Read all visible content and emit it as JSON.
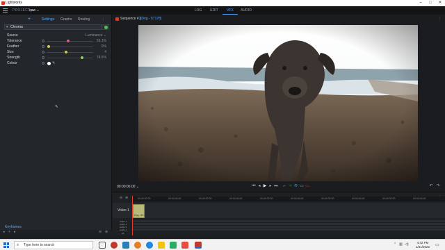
{
  "window": {
    "title": "Lightworks",
    "controls": [
      "–",
      "□",
      "✕"
    ]
  },
  "app": {
    "project_label": "PROJECT",
    "project_name": "qaw ⌄",
    "modes": [
      "LOG",
      "EDIT",
      "VFX",
      "AUDIO"
    ],
    "active_mode": "VFX"
  },
  "left_panel": {
    "add_label": "+",
    "tabs": [
      "Settings",
      "Graphs",
      "Routing"
    ],
    "active_tab": "Settings",
    "effect_name": "Chroma",
    "params": [
      {
        "label": "Source",
        "value": "Luminance ⌄"
      },
      {
        "label": "Tolerance",
        "value": "56.1%",
        "level": 0.45,
        "knob_color": "#d65a8a"
      },
      {
        "label": "Feather",
        "value": "0%",
        "level": 0.0,
        "knob_color": "#d4c84a"
      },
      {
        "label": "Size",
        "value": "4",
        "level": 0.4,
        "knob_color": "#d4c84a"
      },
      {
        "label": "Strength",
        "value": "78.5%",
        "level": 0.78,
        "knob_color": "#8ecf5a"
      },
      {
        "label": "Colour",
        "value": ""
      }
    ],
    "keyframes_label": "Keyframes"
  },
  "viewer": {
    "sequence_title": "Sequence #1",
    "sequence_sub": "[Dog - 57178]",
    "timecode": "00:00:00.00 ⌄"
  },
  "timeline": {
    "ruler_ticks": [
      "00:00:00:00",
      "00:00:00:00",
      "00:00:00:00",
      "00:00:00:00",
      "00:00:00:00",
      "00:00:00:00",
      "00:00:00:00",
      "00:00:00:00",
      "00:00:00:00",
      "00:00:00:00"
    ],
    "video_track_label": "Video 1",
    "clip_label": "Dog - 57...",
    "audio_tracks": [
      "Audio 1",
      "Audio 2",
      "Audio 3",
      "Audio 4"
    ],
    "all_label": "All"
  },
  "taskbar": {
    "search_placeholder": "Type here to search",
    "time": "4:42 PM",
    "date": "1/21/2022"
  },
  "colors": {
    "accent": "#5aa9ff",
    "playhead": "#e23b2e",
    "clip": "#b9b97a"
  }
}
